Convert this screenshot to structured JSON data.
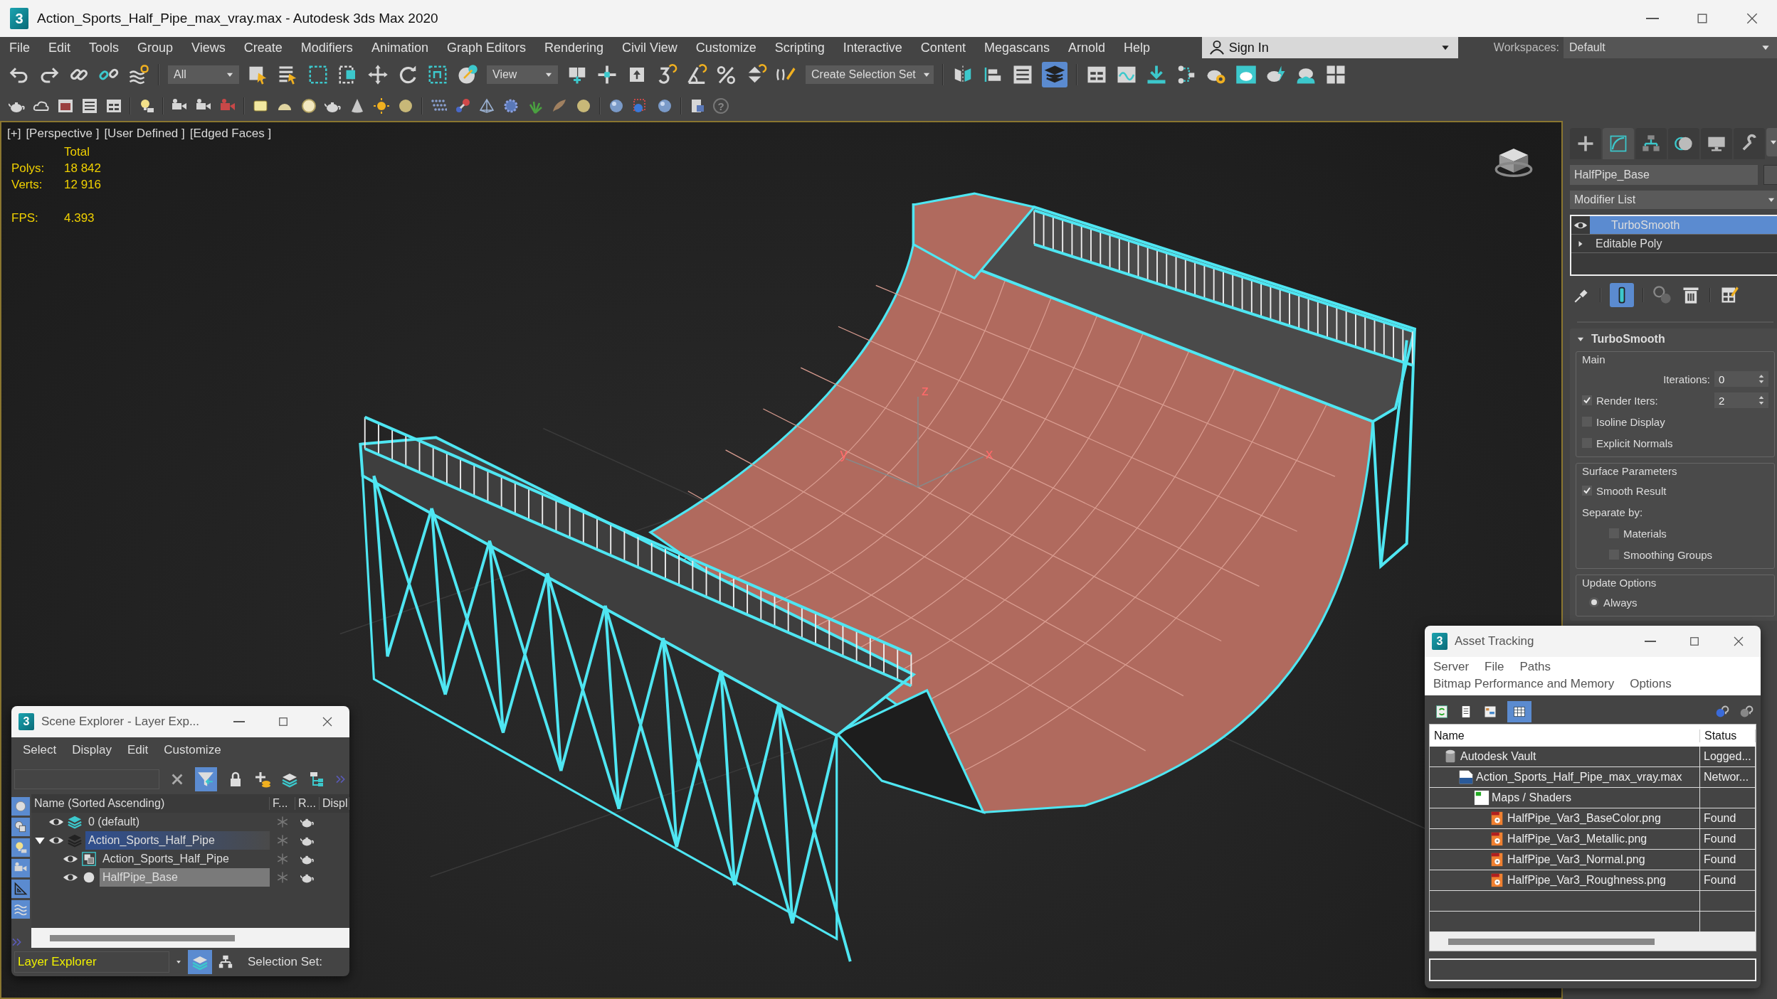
{
  "window": {
    "logo": "3",
    "title": "Action_Sports_Half_Pipe_max_vray.max - Autodesk 3ds Max 2020"
  },
  "menu": [
    "File",
    "Edit",
    "Tools",
    "Group",
    "Views",
    "Create",
    "Modifiers",
    "Animation",
    "Graph Editors",
    "Rendering",
    "Civil View",
    "Customize",
    "Scripting",
    "Interactive",
    "Content",
    "Megascans",
    "Arnold",
    "Help"
  ],
  "account": {
    "sign_in": "Sign In",
    "workspaces_label": "Workspaces:",
    "workspace": "Default"
  },
  "toolbar": {
    "selection_filter": "All",
    "reference_coordinate": "View",
    "selection_set": "Create Selection Set",
    "help_glyph": "?"
  },
  "viewport": {
    "labels": [
      "[+]",
      "[Perspective ]",
      "[User Defined ]",
      "[Edged Faces ]"
    ],
    "stats_header": "Total",
    "stats": [
      {
        "label": "Polys:",
        "value": "18 842"
      },
      {
        "label": "Verts:",
        "value": "12 916"
      },
      {
        "label": "FPS:",
        "value": "4.393"
      }
    ],
    "axis_labels": [
      "z",
      "y",
      "x"
    ]
  },
  "command_panel": {
    "tabs": [
      {
        "selected": false
      },
      {
        "selected": true
      },
      {
        "selected": false
      },
      {
        "selected": false
      },
      {
        "selected": false
      },
      {
        "selected": false
      }
    ],
    "object_name": "HalfPipe_Base",
    "modifier_list": "Modifier List",
    "stack": [
      {
        "label": "TurboSmooth",
        "kind": "modifier",
        "selected": true
      },
      {
        "label": "Editable Poly",
        "kind": "base",
        "selected": false
      }
    ],
    "show_end_result": true,
    "rollout": {
      "title": "TurboSmooth",
      "expanded": true,
      "groups": [
        {
          "title": "Main",
          "controls": [
            {
              "kind": "spinner",
              "label": "Iterations:",
              "value": "0"
            },
            {
              "kind": "check_spinner",
              "label": "Render Iters:",
              "value": "2",
              "checked": true
            },
            {
              "kind": "checkbox",
              "label": "Isoline Display",
              "checked": false
            },
            {
              "kind": "checkbox",
              "label": "Explicit Normals",
              "checked": false
            }
          ]
        },
        {
          "title": "Surface Parameters",
          "controls": [
            {
              "kind": "checkbox",
              "label": "Smooth Result",
              "checked": true
            },
            {
              "kind": "text",
              "label": "Separate by:"
            },
            {
              "kind": "sub_checkbox",
              "label": "Materials",
              "checked": false
            },
            {
              "kind": "sub_checkbox",
              "label": "Smoothing Groups",
              "checked": false
            }
          ]
        },
        {
          "title": "Update Options",
          "controls": [
            {
              "kind": "radio",
              "label": "Always",
              "selected": true
            }
          ]
        }
      ]
    }
  },
  "scene_explorer": {
    "logo": "3",
    "title": "Scene Explorer - Layer Exp...",
    "menu": [
      "Select",
      "Display",
      "Edit",
      "Customize"
    ],
    "columns": [
      "Name (Sorted Ascending)",
      "F...",
      "R...",
      "Displ"
    ],
    "rows": [
      {
        "label": "0 (default)",
        "kind": "layer",
        "selected": false,
        "active": false
      },
      {
        "label": "Action_Sports_Half_Pipe",
        "kind": "layer",
        "selected": false,
        "active": true,
        "expanded": true,
        "children": [
          {
            "label": "Action_Sports_Half_Pipe",
            "kind": "group",
            "selected": false,
            "active": false
          },
          {
            "label": "HalfPipe_Base",
            "kind": "object",
            "selected": true,
            "active": false
          }
        ]
      }
    ],
    "explorer": "Layer Explorer",
    "selection_set_label": "Selection Set:"
  },
  "asset_tracking": {
    "logo": "3",
    "title": "Asset Tracking",
    "menu_rows": [
      [
        "Server",
        "File",
        "Paths"
      ],
      [
        "Bitmap Performance and Memory",
        "Options"
      ]
    ],
    "columns": [
      "Name",
      "Status"
    ],
    "rows": [
      {
        "label": "Autodesk Vault",
        "status": "Logged...",
        "kind": "vault",
        "children": [
          {
            "label": "Action_Sports_Half_Pipe_max_vray.max",
            "status": "Networ...",
            "kind": "max",
            "children": [
              {
                "label": "Maps / Shaders",
                "kind": "folder",
                "children": [
                  {
                    "label": "HalfPipe_Var3_BaseColor.png",
                    "status": "Found",
                    "kind": "png"
                  },
                  {
                    "label": "HalfPipe_Var3_Metallic.png",
                    "status": "Found",
                    "kind": "png"
                  },
                  {
                    "label": "HalfPipe_Var3_Normal.png",
                    "status": "Found",
                    "kind": "png"
                  },
                  {
                    "label": "HalfPipe_Var3_Roughness.png",
                    "status": "Found",
                    "kind": "png"
                  }
                ]
              }
            ]
          }
        ]
      }
    ]
  }
}
